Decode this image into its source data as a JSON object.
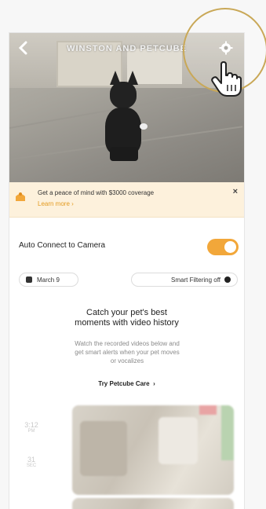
{
  "camera": {
    "title": "WINSTON AND PETCUBE"
  },
  "banner": {
    "text": "Get a peace of mind with $3000 coverage",
    "link": "Learn more",
    "close": "×"
  },
  "auto_connect": {
    "label": "Auto Connect to Camera",
    "enabled": true
  },
  "filters": {
    "date": "March 9",
    "smart_filtering": "Smart Filtering off"
  },
  "promo": {
    "title_line1": "Catch your pet's best",
    "title_line2": "moments with video history",
    "desc_line1": "Watch the recorded videos below and",
    "desc_line2": "get smart alerts when your pet moves",
    "desc_line3": "or vocalizes",
    "cta": "Try Petcube Care"
  },
  "history": [
    {
      "time": "3:12",
      "ampm": "PM",
      "duration": "31",
      "unit": "SEC"
    }
  ],
  "colors": {
    "accent": "#f2a73a",
    "banner_bg": "#fdf1dc",
    "highlight_ring": "#c9a857"
  },
  "icons": {
    "back": "chevron-left-icon",
    "settings": "gear-icon",
    "banner": "insurance-icon",
    "calendar": "calendar-icon",
    "filter": "dot-icon",
    "cursor": "hand-pointer-icon"
  }
}
